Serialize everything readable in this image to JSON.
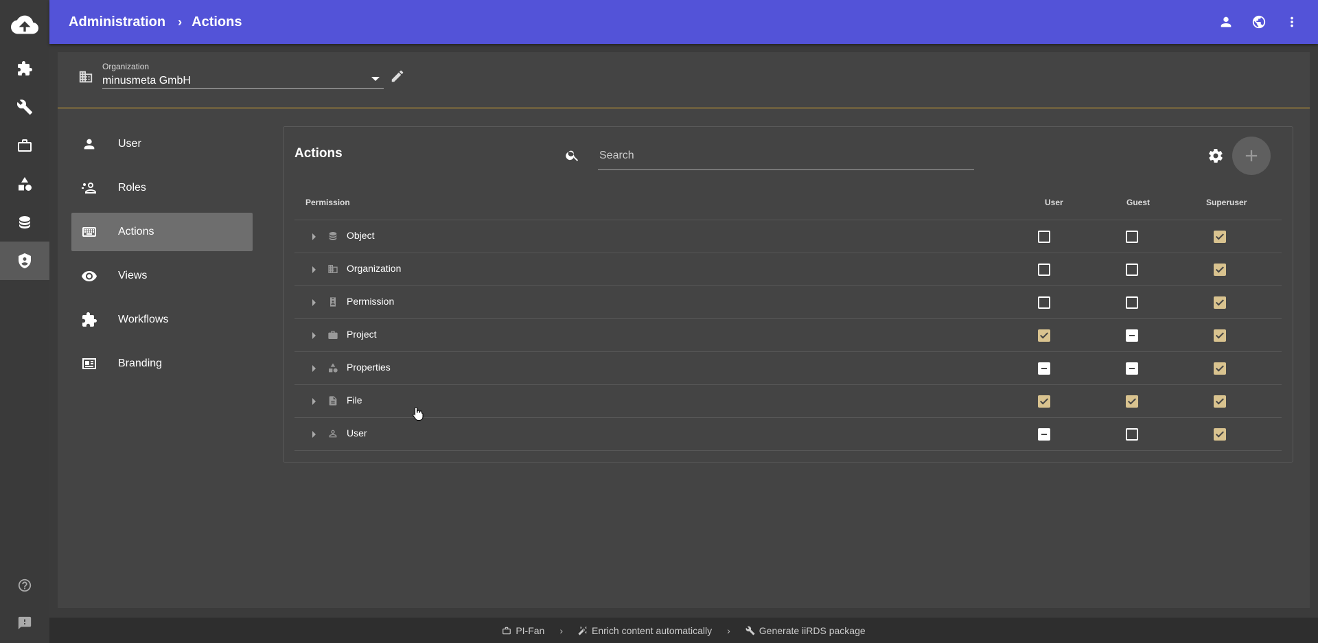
{
  "header": {
    "breadcrumb": [
      "Administration",
      "Actions"
    ],
    "icons": [
      "account-icon",
      "globe-icon",
      "more-vert-icon"
    ]
  },
  "rail": {
    "items": [
      "cloud-upload-icon",
      "puzzle-icon",
      "wrench-icon",
      "briefcase-icon",
      "shapes-icon",
      "database-icon",
      "shield-account-icon"
    ],
    "active_index": 6,
    "bottom": [
      "help-icon",
      "feedback-icon"
    ]
  },
  "organization": {
    "label": "Organization",
    "value": "minusmeta GmbH"
  },
  "nav": {
    "items": [
      {
        "label": "User",
        "icon": "person-icon"
      },
      {
        "label": "Roles",
        "icon": "roles-icon"
      },
      {
        "label": "Actions",
        "icon": "keyboard-icon",
        "active": true
      },
      {
        "label": "Views",
        "icon": "eye-icon"
      },
      {
        "label": "Workflows",
        "icon": "puzzle-icon"
      },
      {
        "label": "Branding",
        "icon": "branding-icon"
      }
    ]
  },
  "panel": {
    "title": "Actions",
    "search_placeholder": "Search",
    "columns": [
      "Permission",
      "User",
      "Guest",
      "Superuser"
    ],
    "rows": [
      {
        "label": "Object",
        "icon": "database-icon",
        "user": "unchecked",
        "guest": "unchecked",
        "superuser": "checked"
      },
      {
        "label": "Organization",
        "icon": "domain-icon",
        "user": "unchecked",
        "guest": "unchecked",
        "superuser": "checked"
      },
      {
        "label": "Permission",
        "icon": "badge-icon",
        "user": "unchecked",
        "guest": "unchecked",
        "superuser": "checked"
      },
      {
        "label": "Project",
        "icon": "briefcase-icon",
        "user": "checked",
        "guest": "partial",
        "superuser": "checked"
      },
      {
        "label": "Properties",
        "icon": "shapes-icon",
        "user": "partial",
        "guest": "partial",
        "superuser": "checked"
      },
      {
        "label": "File",
        "icon": "file-icon",
        "user": "checked",
        "guest": "checked",
        "superuser": "checked"
      },
      {
        "label": "User",
        "icon": "person-outline-icon",
        "user": "partial",
        "guest": "unchecked",
        "superuser": "checked"
      }
    ]
  },
  "bottombar": {
    "items": [
      {
        "label": "PI-Fan",
        "icon": "briefcase-outline-icon"
      },
      {
        "label": "Enrich content automatically",
        "icon": "magic-wand-icon"
      },
      {
        "label": "Generate iiRDS package",
        "icon": "wrench-icon"
      }
    ]
  },
  "colors": {
    "topbar": "#5353d8",
    "checked": "#d9c38f",
    "divider": "#6c5f3f"
  }
}
